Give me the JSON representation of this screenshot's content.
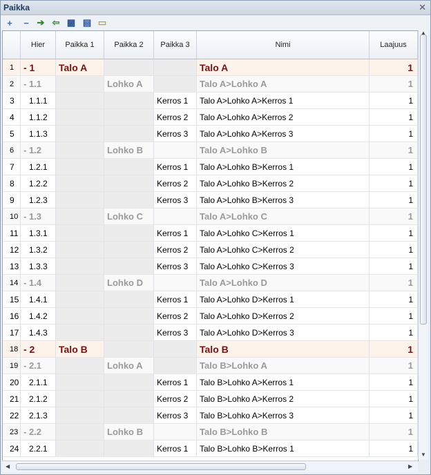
{
  "window": {
    "title": "Paikka",
    "close_glyph": "✕"
  },
  "toolbar": [
    {
      "name": "add-icon",
      "glyph": "+",
      "color": "#2a6fd1"
    },
    {
      "name": "remove-icon",
      "glyph": "−",
      "color": "#2a6fd1"
    },
    {
      "name": "arrow-right-icon",
      "glyph": "➔",
      "color": "#2e8b2e"
    },
    {
      "name": "arrow-left-icon",
      "glyph": "⇦",
      "color": "#2e8b2e"
    },
    {
      "name": "insert-row-icon",
      "glyph": "▦",
      "color": "#2a4f8c"
    },
    {
      "name": "grid-icon",
      "glyph": "▤",
      "color": "#2a4f8c"
    },
    {
      "name": "edit-icon",
      "glyph": "▭",
      "color": "#b6a04a"
    }
  ],
  "columns": [
    "",
    "Hier",
    "Paikka 1",
    "Paikka 2",
    "Paikka 3",
    "Nimi",
    "Laajuus"
  ],
  "rows": [
    {
      "n": "1",
      "hier": "- 1",
      "p1": "Talo A",
      "p2": "",
      "p3": "",
      "nimi": "Talo A",
      "laajuus": "1",
      "lvl": 1
    },
    {
      "n": "2",
      "hier": "- 1.1",
      "p1": "",
      "p2": "Lohko A",
      "p3": "",
      "nimi": "Talo A>Lohko A",
      "laajuus": "1",
      "lvl": 2
    },
    {
      "n": "3",
      "hier": "1.1.1",
      "p1": "",
      "p2": "",
      "p3": "Kerros 1",
      "nimi": "Talo A>Lohko A>Kerros 1",
      "laajuus": "1",
      "lvl": 3
    },
    {
      "n": "4",
      "hier": "1.1.2",
      "p1": "",
      "p2": "",
      "p3": "Kerros 2",
      "nimi": "Talo A>Lohko A>Kerros 2",
      "laajuus": "1",
      "lvl": 3
    },
    {
      "n": "5",
      "hier": "1.1.3",
      "p1": "",
      "p2": "",
      "p3": "Kerros 3",
      "nimi": "Talo A>Lohko A>Kerros 3",
      "laajuus": "1",
      "lvl": 3
    },
    {
      "n": "6",
      "hier": "- 1.2",
      "p1": "",
      "p2": "Lohko B",
      "p3": "",
      "nimi": "Talo A>Lohko B",
      "laajuus": "1",
      "lvl": 2
    },
    {
      "n": "7",
      "hier": "1.2.1",
      "p1": "",
      "p2": "",
      "p3": "Kerros 1",
      "nimi": "Talo A>Lohko B>Kerros 1",
      "laajuus": "1",
      "lvl": 3
    },
    {
      "n": "8",
      "hier": "1.2.2",
      "p1": "",
      "p2": "",
      "p3": "Kerros 2",
      "nimi": "Talo A>Lohko B>Kerros 2",
      "laajuus": "1",
      "lvl": 3
    },
    {
      "n": "9",
      "hier": "1.2.3",
      "p1": "",
      "p2": "",
      "p3": "Kerros 3",
      "nimi": "Talo A>Lohko B>Kerros 3",
      "laajuus": "1",
      "lvl": 3
    },
    {
      "n": "10",
      "hier": "- 1.3",
      "p1": "",
      "p2": "Lohko C",
      "p3": "",
      "nimi": "Talo A>Lohko C",
      "laajuus": "1",
      "lvl": 2
    },
    {
      "n": "11",
      "hier": "1.3.1",
      "p1": "",
      "p2": "",
      "p3": "Kerros 1",
      "nimi": "Talo A>Lohko C>Kerros 1",
      "laajuus": "1",
      "lvl": 3
    },
    {
      "n": "12",
      "hier": "1.3.2",
      "p1": "",
      "p2": "",
      "p3": "Kerros 2",
      "nimi": "Talo A>Lohko C>Kerros 2",
      "laajuus": "1",
      "lvl": 3
    },
    {
      "n": "13",
      "hier": "1.3.3",
      "p1": "",
      "p2": "",
      "p3": "Kerros 3",
      "nimi": "Talo A>Lohko C>Kerros 3",
      "laajuus": "1",
      "lvl": 3
    },
    {
      "n": "14",
      "hier": "- 1.4",
      "p1": "",
      "p2": "Lohko D",
      "p3": "",
      "nimi": "Talo A>Lohko D",
      "laajuus": "1",
      "lvl": 2
    },
    {
      "n": "15",
      "hier": "1.4.1",
      "p1": "",
      "p2": "",
      "p3": "Kerros 1",
      "nimi": "Talo A>Lohko D>Kerros 1",
      "laajuus": "1",
      "lvl": 3
    },
    {
      "n": "16",
      "hier": "1.4.2",
      "p1": "",
      "p2": "",
      "p3": "Kerros 2",
      "nimi": "Talo A>Lohko D>Kerros 2",
      "laajuus": "1",
      "lvl": 3
    },
    {
      "n": "17",
      "hier": "1.4.3",
      "p1": "",
      "p2": "",
      "p3": "Kerros 3",
      "nimi": "Talo A>Lohko D>Kerros 3",
      "laajuus": "1",
      "lvl": 3
    },
    {
      "n": "18",
      "hier": "- 2",
      "p1": "Talo B",
      "p2": "",
      "p3": "",
      "nimi": "Talo B",
      "laajuus": "1",
      "lvl": 1
    },
    {
      "n": "19",
      "hier": "- 2.1",
      "p1": "",
      "p2": "Lohko A",
      "p3": "",
      "nimi": "Talo B>Lohko A",
      "laajuus": "1",
      "lvl": 2
    },
    {
      "n": "20",
      "hier": "2.1.1",
      "p1": "",
      "p2": "",
      "p3": "Kerros 1",
      "nimi": "Talo B>Lohko A>Kerros 1",
      "laajuus": "1",
      "lvl": 3
    },
    {
      "n": "21",
      "hier": "2.1.2",
      "p1": "",
      "p2": "",
      "p3": "Kerros 2",
      "nimi": "Talo B>Lohko A>Kerros 2",
      "laajuus": "1",
      "lvl": 3
    },
    {
      "n": "22",
      "hier": "2.1.3",
      "p1": "",
      "p2": "",
      "p3": "Kerros 3",
      "nimi": "Talo B>Lohko A>Kerros 3",
      "laajuus": "1",
      "lvl": 3
    },
    {
      "n": "23",
      "hier": "- 2.2",
      "p1": "",
      "p2": "Lohko B",
      "p3": "",
      "nimi": "Talo B>Lohko B",
      "laajuus": "1",
      "lvl": 2
    },
    {
      "n": "24",
      "hier": "2.2.1",
      "p1": "",
      "p2": "",
      "p3": "Kerros 1",
      "nimi": "Talo B>Lohko B>Kerros 1",
      "laajuus": "1",
      "lvl": 3
    }
  ]
}
